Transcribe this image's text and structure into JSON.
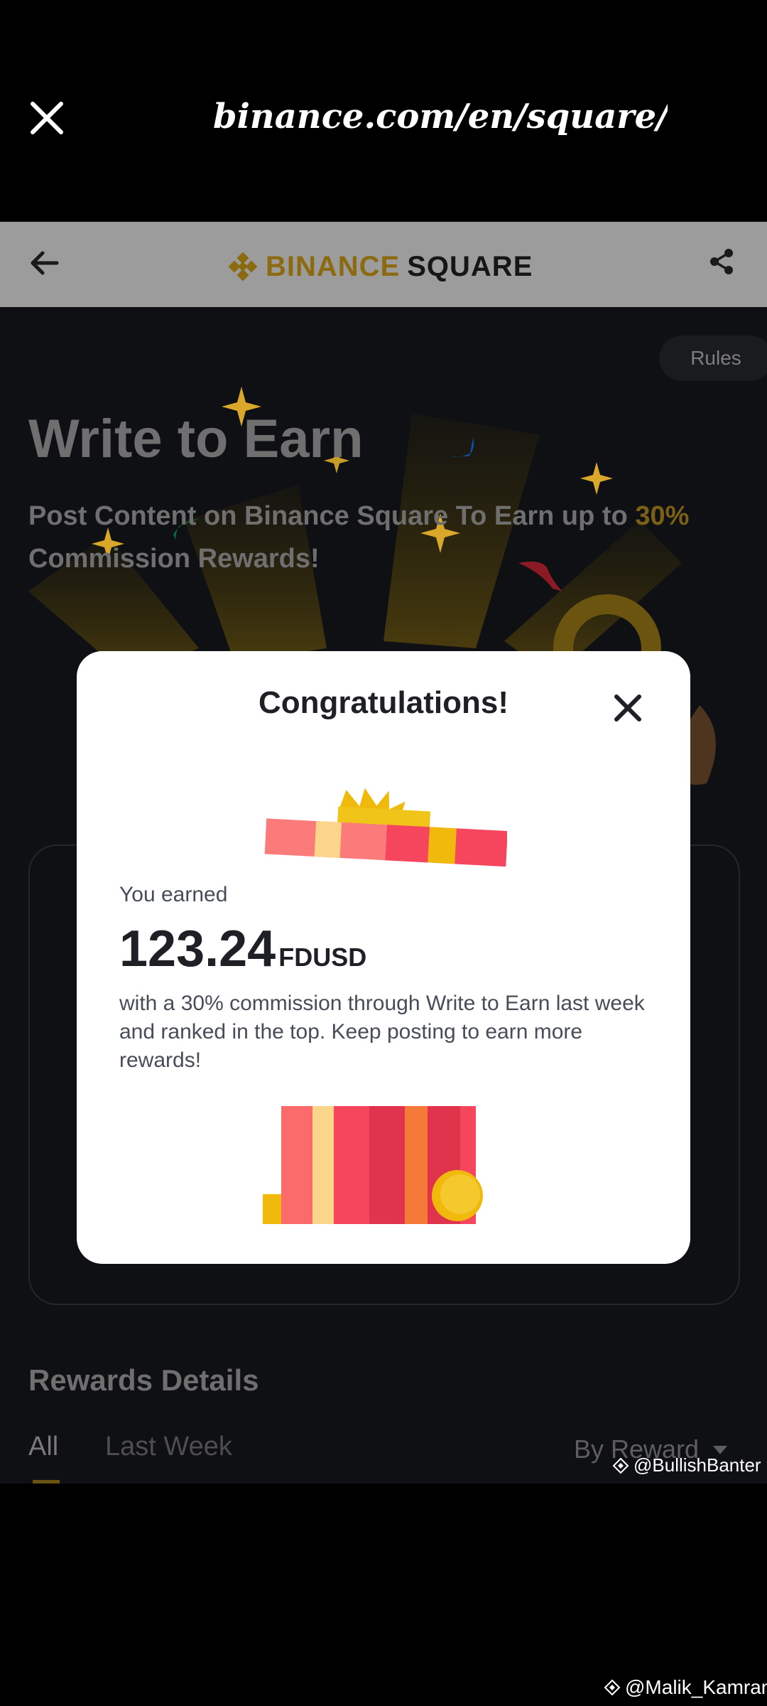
{
  "browser": {
    "url": "binance.com/en/square/po..."
  },
  "header": {
    "logo_brand": "BINANCE",
    "logo_product": "SQUARE"
  },
  "page": {
    "rules_label": "Rules",
    "title": "Write to Earn",
    "subtitle_prefix": "Post Content on Binance Square To Earn up to ",
    "subtitle_highlight": "30%",
    "subtitle_suffix": " Commission Rewards!",
    "rewards_title": "Rewards Details",
    "tabs": [
      {
        "label": "All",
        "active": true
      },
      {
        "label": "Last Week",
        "active": false
      }
    ],
    "sort_label": "By Reward"
  },
  "modal": {
    "title": "Congratulations!",
    "you_earned_label": "You earned",
    "amount": "123.24",
    "currency": "FDUSD",
    "description": "with a 30% commission through Write to Earn last week and ranked in the top. Keep posting to earn more rewards!"
  },
  "watermarks": {
    "overlay_handle": "@BullishBanter",
    "footer_handle": "@Malik_Kamran"
  },
  "colors": {
    "binance_yellow": "#f0b90b",
    "modal_bg": "#ffffff",
    "gift_red": "#f6465d"
  }
}
